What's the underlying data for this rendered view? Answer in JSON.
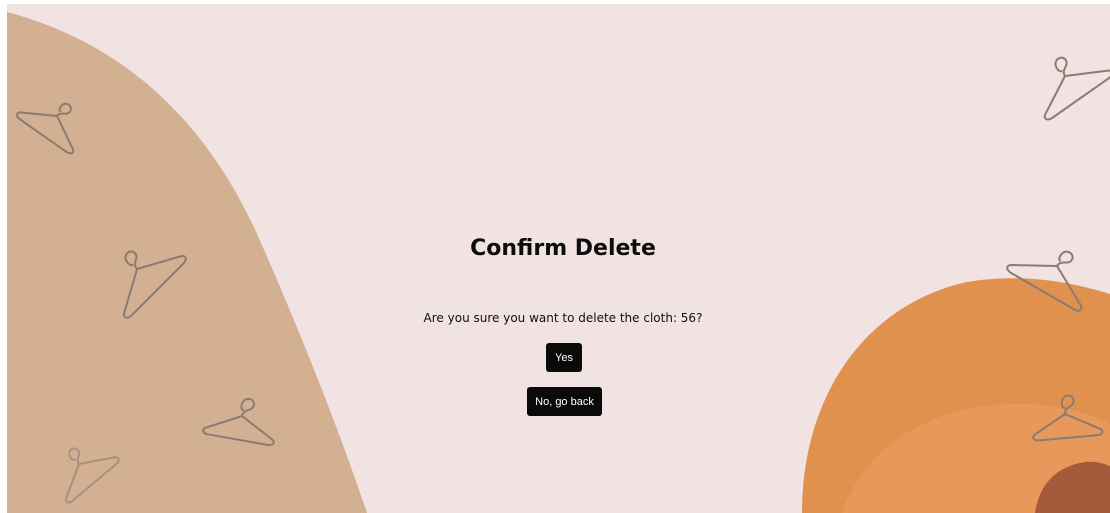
{
  "dialog": {
    "title": "Confirm Delete",
    "message": "Are you sure you want to delete the cloth: 56?",
    "confirm_label": "Yes",
    "cancel_label": "No, go back"
  },
  "colors": {
    "background": "#f0e3e1",
    "left_blob": "#d4b093",
    "orange_outer": "#e0914d",
    "orange_inner": "#e8985a",
    "brown_circle": "#a55a3c",
    "hanger_stroke": "#8a7b73",
    "button_bg": "#0a0a0a",
    "button_text": "#ffffff"
  },
  "decorations": {
    "hanger_icon": "clothes-hanger-icon"
  }
}
